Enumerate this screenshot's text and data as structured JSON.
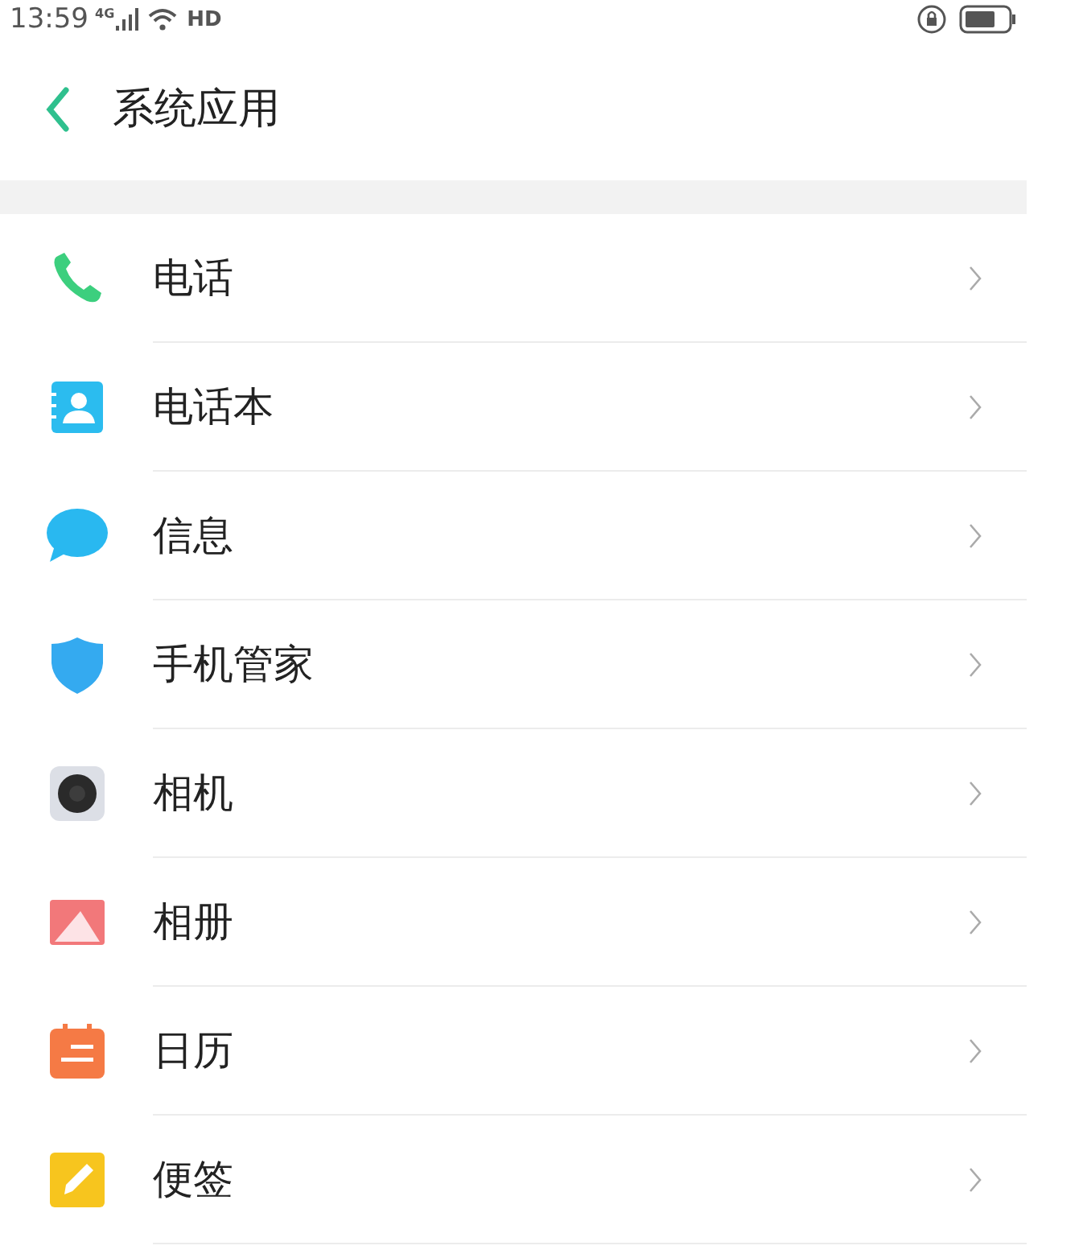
{
  "status_bar": {
    "time": "13:59",
    "network": "4G",
    "hd": "HD"
  },
  "header": {
    "title": "系统应用"
  },
  "items": [
    {
      "label": "电话",
      "kind": "phone"
    },
    {
      "label": "电话本",
      "kind": "contacts"
    },
    {
      "label": "信息",
      "kind": "messages"
    },
    {
      "label": "手机管家",
      "kind": "security"
    },
    {
      "label": "相机",
      "kind": "camera"
    },
    {
      "label": "相册",
      "kind": "gallery"
    },
    {
      "label": "日历",
      "kind": "calendar"
    },
    {
      "label": "便签",
      "kind": "notes"
    }
  ]
}
